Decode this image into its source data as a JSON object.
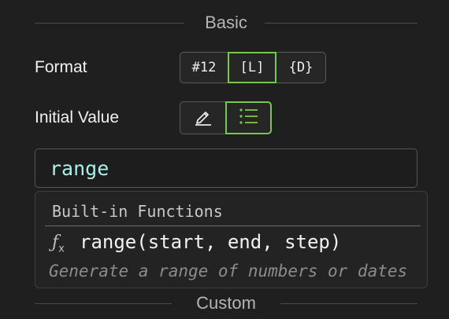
{
  "sections": {
    "basic": "Basic",
    "custom": "Custom"
  },
  "format": {
    "label": "Format",
    "options": [
      "#12",
      "[L]",
      "{D}"
    ],
    "selected": "[L]"
  },
  "initial_value": {
    "label": "Initial Value",
    "options": [
      "pencil-icon",
      "list-icon"
    ],
    "selected": "list-icon"
  },
  "input": {
    "value": "range"
  },
  "suggestions": {
    "heading": "Built-in Functions",
    "items": [
      {
        "icon": "function-icon",
        "signature": "range(start, end, step)",
        "description": "Generate a range of numbers or dates"
      }
    ]
  },
  "colors": {
    "accent": "#7ac74f",
    "input_text": "#a9f0ea",
    "background": "#1f1f1f"
  }
}
